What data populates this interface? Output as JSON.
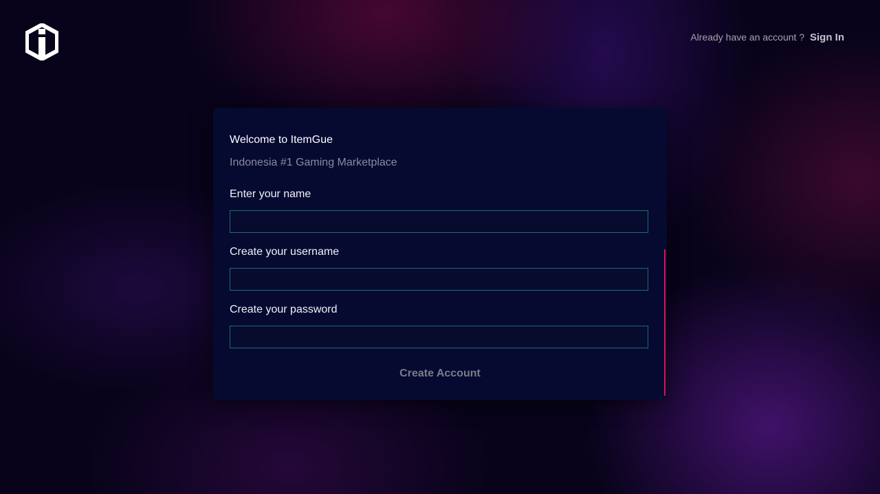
{
  "brand": {
    "logo_icon": "itemgue-logo-icon"
  },
  "header": {
    "account_prompt": "Already have an account ?",
    "signin_label": "Sign In"
  },
  "form": {
    "title": "Welcome to ItemGue",
    "subtitle": "Indonesia #1 Gaming Marketplace",
    "name_label": "Enter your name",
    "name_value": "",
    "username_label": "Create your username",
    "username_value": "",
    "password_label": "Create your password",
    "password_value": "",
    "submit_label": "Create Account"
  },
  "colors": {
    "card_bg": "#060a31",
    "input_border": "#1b6c78",
    "accent": "#e0124f"
  }
}
